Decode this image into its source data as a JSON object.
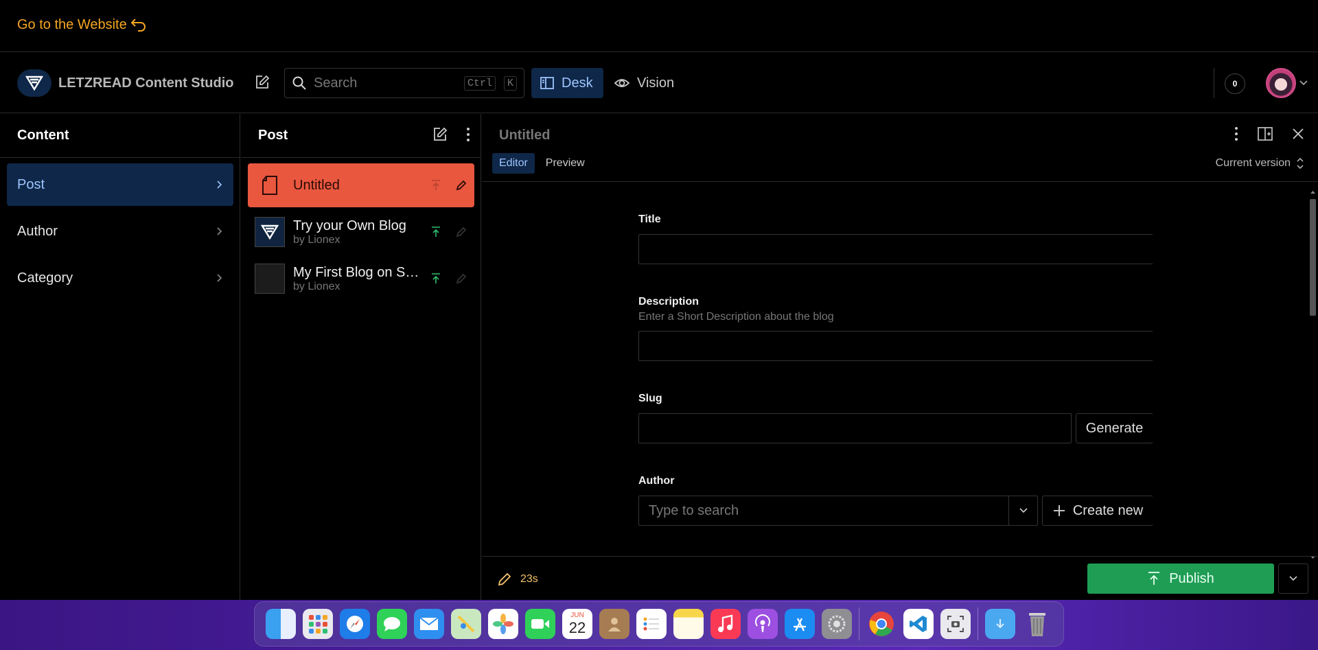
{
  "topbar": {
    "go_to_website": "Go to the Website"
  },
  "navbar": {
    "brand": "LETZREAD Content Studio",
    "search_placeholder": "Search",
    "shortcut_key1": "Ctrl",
    "shortcut_key2": "K",
    "desk_label": "Desk",
    "vision_label": "Vision",
    "notification_count": "0"
  },
  "content_pane": {
    "title": "Content",
    "items": [
      {
        "label": "Post"
      },
      {
        "label": "Author"
      },
      {
        "label": "Category"
      }
    ]
  },
  "post_pane": {
    "title": "Post",
    "documents": [
      {
        "title": "Untitled",
        "subtitle": ""
      },
      {
        "title": "Try your Own Blog",
        "subtitle": "by Lionex"
      },
      {
        "title": "My First Blog on S…",
        "subtitle": "by Lionex"
      }
    ]
  },
  "document": {
    "title": "Untitled",
    "tabs": {
      "editor": "Editor",
      "preview": "Preview"
    },
    "version": "Current version",
    "fields": {
      "title_label": "Title",
      "description_label": "Description",
      "description_hint": "Enter a Short Description about the blog",
      "slug_label": "Slug",
      "generate_label": "Generate",
      "author_label": "Author",
      "author_placeholder": "Type to search",
      "create_new_label": "Create new"
    },
    "footer": {
      "status_time": "23s",
      "publish_label": "Publish"
    }
  },
  "dock": {
    "calendar_month": "JUN",
    "calendar_day": "22"
  },
  "colors": {
    "accent": "#9ec5ff",
    "active_doc": "#e9573f",
    "publish": "#1f9d55",
    "link": "#f5a623"
  }
}
